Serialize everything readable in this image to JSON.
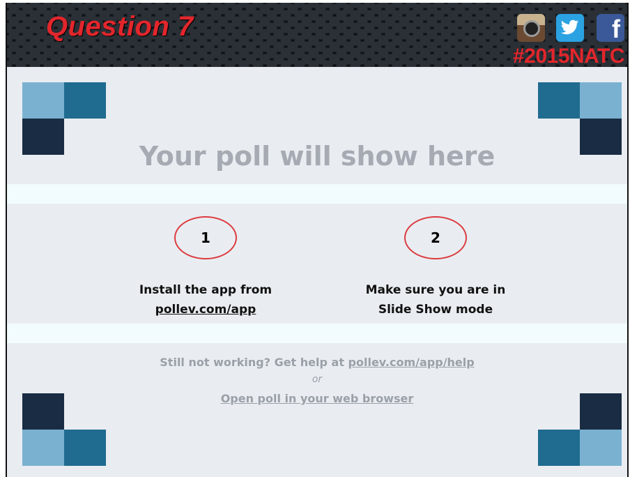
{
  "header": {
    "title": "Question 7",
    "hashtag": "#2015NATC",
    "social_icons": [
      "instagram-icon",
      "twitter-icon",
      "facebook-icon"
    ],
    "facebook_glyph": "f"
  },
  "poll": {
    "title": "Your poll will show here"
  },
  "steps": [
    {
      "number": "1",
      "line1": "Install the app from",
      "line2": "pollev.com/app"
    },
    {
      "number": "2",
      "line1": "Make sure you are in",
      "line2": "Slide Show mode"
    }
  ],
  "help": {
    "prefix": "Still not working? Get help at ",
    "link": "pollev.com/app/help",
    "or": "or",
    "browser_link": "Open poll in your web browser"
  },
  "colors": {
    "accent_red": "#e2262c",
    "tile_light": "#7ab1d0",
    "tile_mid": "#206b90",
    "tile_dark": "#1a2c43"
  }
}
